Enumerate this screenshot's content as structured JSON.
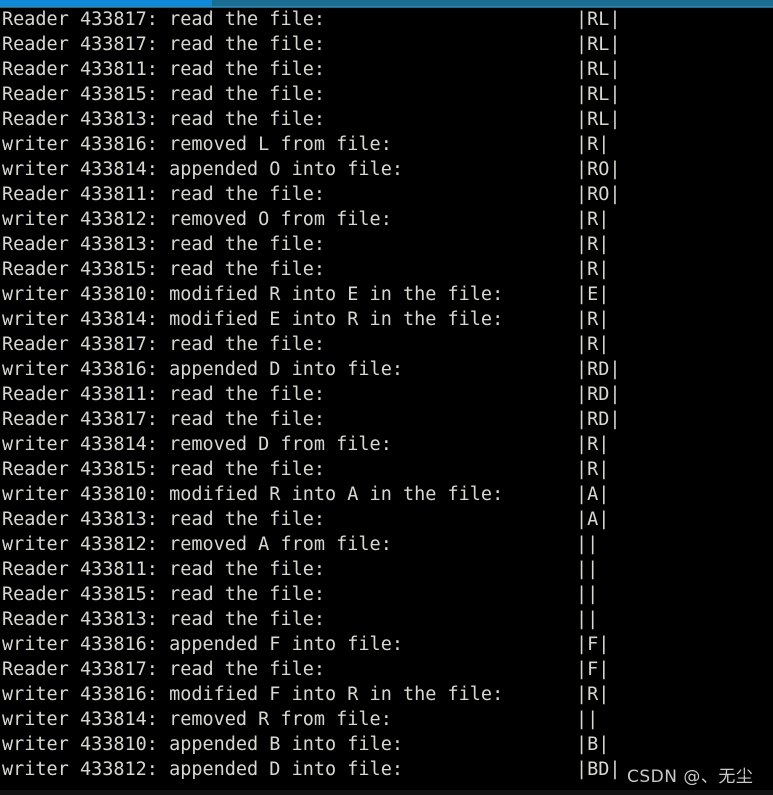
{
  "terminal": {
    "background_color": "#000000",
    "foreground_color": "#d8d8d2",
    "accent_color": "#1289d8",
    "columns_note": "monospace log output of reader/writer synchronization demo",
    "scrollbar": {
      "name": "top-progress-bar",
      "fill_color": "#1289d8",
      "track_color": "#1b6d92"
    },
    "lines": [
      {
        "message": "Reader 433817: read the file:",
        "content": "|RL|"
      },
      {
        "message": "Reader 433817: read the file:",
        "content": "|RL|"
      },
      {
        "message": "Reader 433811: read the file:",
        "content": "|RL|"
      },
      {
        "message": "Reader 433815: read the file:",
        "content": "|RL|"
      },
      {
        "message": "Reader 433813: read the file:",
        "content": "|RL|"
      },
      {
        "message": "writer 433816: removed L from file:",
        "content": "|R|"
      },
      {
        "message": "writer 433814: appended O into file:",
        "content": "|RO|"
      },
      {
        "message": "Reader 433811: read the file:",
        "content": "|RO|"
      },
      {
        "message": "writer 433812: removed O from file:",
        "content": "|R|"
      },
      {
        "message": "Reader 433813: read the file:",
        "content": "|R|"
      },
      {
        "message": "Reader 433815: read the file:",
        "content": "|R|"
      },
      {
        "message": "writer 433810: modified R into E in the file:",
        "content": "|E|"
      },
      {
        "message": "writer 433814: modified E into R in the file:",
        "content": "|R|"
      },
      {
        "message": "Reader 433817: read the file:",
        "content": "|R|"
      },
      {
        "message": "writer 433816: appended D into file:",
        "content": "|RD|"
      },
      {
        "message": "Reader 433811: read the file:",
        "content": "|RD|"
      },
      {
        "message": "Reader 433817: read the file:",
        "content": "|RD|"
      },
      {
        "message": "writer 433814: removed D from file:",
        "content": "|R|"
      },
      {
        "message": "Reader 433815: read the file:",
        "content": "|R|"
      },
      {
        "message": "writer 433810: modified R into A in the file:",
        "content": "|A|"
      },
      {
        "message": "Reader 433813: read the file:",
        "content": "|A|"
      },
      {
        "message": "writer 433812: removed A from file:",
        "content": "||"
      },
      {
        "message": "Reader 433811: read the file:",
        "content": "||"
      },
      {
        "message": "Reader 433815: read the file:",
        "content": "||"
      },
      {
        "message": "Reader 433813: read the file:",
        "content": "||"
      },
      {
        "message": "writer 433816: appended F into file:",
        "content": "|F|"
      },
      {
        "message": "Reader 433817: read the file:",
        "content": "|F|"
      },
      {
        "message": "writer 433816: modified F into R in the file:",
        "content": "|R|"
      },
      {
        "message": "writer 433814: removed R from file:",
        "content": "||"
      },
      {
        "message": "writer 433810: appended B into file:",
        "content": "|B|"
      },
      {
        "message": "writer 433812: appended D into file:",
        "content": "|BD|"
      }
    ]
  },
  "watermark": {
    "text": "CSDN @、无尘"
  }
}
